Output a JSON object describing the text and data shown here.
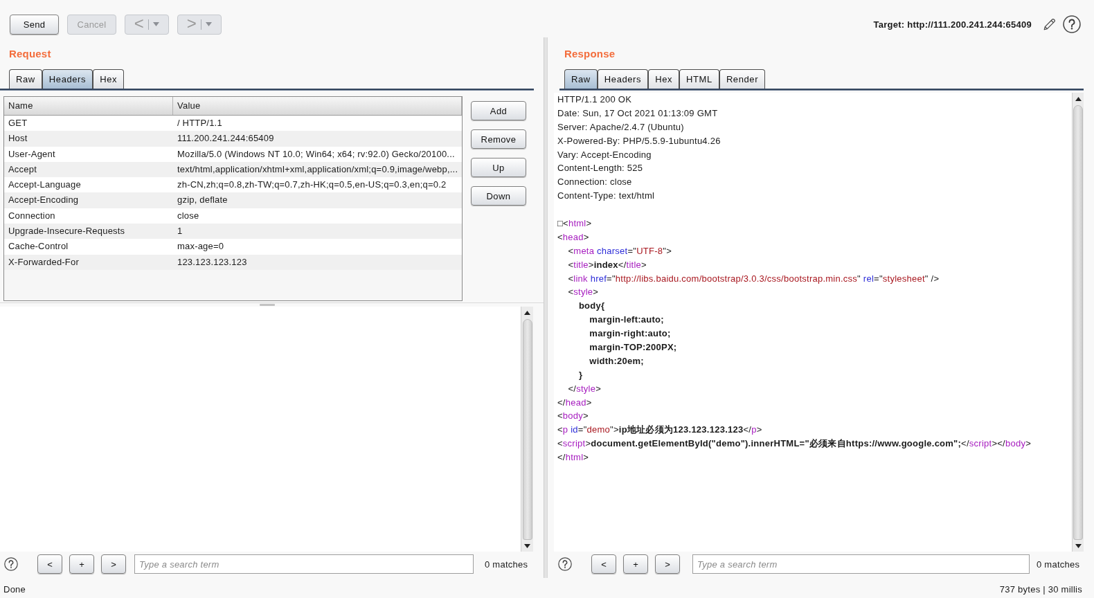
{
  "toolbar": {
    "buttons": [
      {
        "kind": "text",
        "label": "Send",
        "disabled": false
      },
      {
        "kind": "text",
        "label": "Cancel",
        "disabled": true
      },
      {
        "kind": "history",
        "label": "<",
        "disabled": true
      },
      {
        "kind": "history",
        "label": ">",
        "disabled": true
      }
    ],
    "target": "Target: http://111.200.241.244:65409"
  },
  "request": {
    "title": "Request",
    "tabs": [
      {
        "label": "Raw",
        "selected": false
      },
      {
        "label": "Headers",
        "selected": true
      },
      {
        "label": "Hex",
        "selected": false
      }
    ],
    "headers_table": {
      "columns": [
        "Name",
        "Value"
      ],
      "rows": [
        [
          "GET",
          "/ HTTP/1.1"
        ],
        [
          "Host",
          "111.200.241.244:65409"
        ],
        [
          "User-Agent",
          "Mozilla/5.0 (Windows NT 10.0; Win64; x64; rv:92.0) Gecko/20100..."
        ],
        [
          "Accept",
          "text/html,application/xhtml+xml,application/xml;q=0.9,image/webp,..."
        ],
        [
          "Accept-Language",
          "zh-CN,zh;q=0.8,zh-TW;q=0.7,zh-HK;q=0.5,en-US;q=0.3,en;q=0.2"
        ],
        [
          "Accept-Encoding",
          "gzip, deflate"
        ],
        [
          "Connection",
          "close"
        ],
        [
          "Upgrade-Insecure-Requests",
          "1"
        ],
        [
          "Cache-Control",
          "max-age=0"
        ],
        [
          "X-Forwarded-For",
          "123.123.123.123"
        ]
      ]
    },
    "table_buttons": [
      "Add",
      "Remove",
      "Up",
      "Down"
    ],
    "search": {
      "buttons": [
        "<",
        "+",
        ">"
      ],
      "placeholder": "Type a search term",
      "matches": "0 matches"
    }
  },
  "response": {
    "title": "Response",
    "tabs": [
      {
        "label": "Raw",
        "selected": true
      },
      {
        "label": "Headers",
        "selected": false
      },
      {
        "label": "Hex",
        "selected": false
      },
      {
        "label": "HTML",
        "selected": false
      },
      {
        "label": "Render",
        "selected": false
      }
    ],
    "headers": [
      "HTTP/1.1 200 OK",
      "Date: Sun, 17 Oct 2021 01:13:09 GMT",
      "Server: Apache/2.4.7 (Ubuntu)",
      "X-Powered-By: PHP/5.5.9-1ubuntu4.26",
      "Vary: Accept-Encoding",
      "Content-Length: 525",
      "Connection: close",
      "Content-Type: text/html"
    ],
    "body": [
      [
        {
          "kind": "plain",
          "text": "□<"
        },
        {
          "kind": "tag",
          "text": "html"
        },
        {
          "kind": "plain",
          "text": ">"
        }
      ],
      [
        {
          "kind": "plain",
          "text": "<"
        },
        {
          "kind": "tag",
          "text": "head"
        },
        {
          "kind": "plain",
          "text": ">"
        }
      ],
      [
        {
          "kind": "plain",
          "text": "    <"
        },
        {
          "kind": "tag",
          "text": "meta"
        },
        {
          "kind": "attr",
          "text": " charset"
        },
        {
          "kind": "plain",
          "text": "=\""
        },
        {
          "kind": "value",
          "text": "UTF-8"
        },
        {
          "kind": "plain",
          "text": "\">"
        }
      ],
      [
        {
          "kind": "plain",
          "text": "    <"
        },
        {
          "kind": "tag",
          "text": "title"
        },
        {
          "kind": "plain",
          "text": ">"
        },
        {
          "kind": "text",
          "text": "index"
        },
        {
          "kind": "plain",
          "text": "</"
        },
        {
          "kind": "tag",
          "text": "title"
        },
        {
          "kind": "plain",
          "text": ">"
        }
      ],
      [
        {
          "kind": "plain",
          "text": "    <"
        },
        {
          "kind": "tag",
          "text": "link"
        },
        {
          "kind": "attr",
          "text": " href"
        },
        {
          "kind": "plain",
          "text": "=\""
        },
        {
          "kind": "value",
          "text": "http://libs.baidu.com/bootstrap/3.0.3/css/bootstrap.min.css"
        },
        {
          "kind": "plain",
          "text": "\" "
        },
        {
          "kind": "attr",
          "text": "rel"
        },
        {
          "kind": "plain",
          "text": "=\""
        },
        {
          "kind": "value",
          "text": "stylesheet"
        },
        {
          "kind": "plain",
          "text": "\" />"
        }
      ],
      [
        {
          "kind": "plain",
          "text": "    <"
        },
        {
          "kind": "tag",
          "text": "style"
        },
        {
          "kind": "plain",
          "text": ">"
        }
      ],
      [
        {
          "kind": "text",
          "text": "        body{"
        }
      ],
      [
        {
          "kind": "text",
          "text": "            margin-left:auto;"
        }
      ],
      [
        {
          "kind": "text",
          "text": "            margin-right:auto;"
        }
      ],
      [
        {
          "kind": "text",
          "text": "            margin-TOP:200PX;"
        }
      ],
      [
        {
          "kind": "text",
          "text": "            width:20em;"
        }
      ],
      [
        {
          "kind": "text",
          "text": "        }"
        }
      ],
      [
        {
          "kind": "plain",
          "text": "    </"
        },
        {
          "kind": "tag",
          "text": "style"
        },
        {
          "kind": "plain",
          "text": ">"
        }
      ],
      [
        {
          "kind": "plain",
          "text": "</"
        },
        {
          "kind": "tag",
          "text": "head"
        },
        {
          "kind": "plain",
          "text": ">"
        }
      ],
      [
        {
          "kind": "plain",
          "text": "<"
        },
        {
          "kind": "tag",
          "text": "body"
        },
        {
          "kind": "plain",
          "text": ">"
        }
      ],
      [
        {
          "kind": "plain",
          "text": "<"
        },
        {
          "kind": "tag",
          "text": "p"
        },
        {
          "kind": "attr",
          "text": " id"
        },
        {
          "kind": "plain",
          "text": "=\""
        },
        {
          "kind": "value",
          "text": "demo"
        },
        {
          "kind": "plain",
          "text": "\">"
        },
        {
          "kind": "text",
          "text": "ip地址必须为123.123.123.123"
        },
        {
          "kind": "plain",
          "text": "</"
        },
        {
          "kind": "tag",
          "text": "p"
        },
        {
          "kind": "plain",
          "text": ">"
        }
      ],
      [
        {
          "kind": "plain",
          "text": "<"
        },
        {
          "kind": "tag",
          "text": "script"
        },
        {
          "kind": "plain",
          "text": ">"
        },
        {
          "kind": "text",
          "text": "document.getElementById(\"demo\").innerHTML=\"必须来自https://www.google.com\";"
        },
        {
          "kind": "plain",
          "text": "</"
        },
        {
          "kind": "tag",
          "text": "script"
        },
        {
          "kind": "plain",
          "text": "></"
        },
        {
          "kind": "tag",
          "text": "body"
        },
        {
          "kind": "plain",
          "text": ">"
        }
      ],
      [
        {
          "kind": "plain",
          "text": "</"
        },
        {
          "kind": "tag",
          "text": "html"
        },
        {
          "kind": "plain",
          "text": ">"
        }
      ]
    ],
    "search": {
      "buttons": [
        "<",
        "+",
        ">"
      ],
      "placeholder": "Type a search term",
      "matches": "0 matches"
    }
  },
  "status_bar": {
    "message": "Done",
    "stats": "737 bytes | 30 millis"
  }
}
